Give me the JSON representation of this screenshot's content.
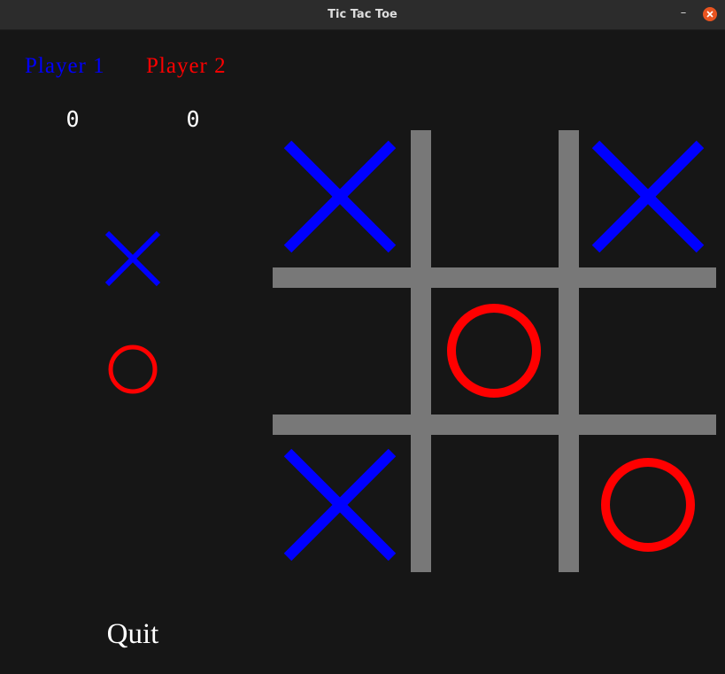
{
  "window": {
    "title": "Tic Tac Toe"
  },
  "players": [
    {
      "label": "Player 1",
      "score": "0",
      "mark": "X",
      "color": "#0000ff"
    },
    {
      "label": "Player 2",
      "score": "0",
      "mark": "O",
      "color": "#ff0000"
    }
  ],
  "quit_label": "Quit",
  "board": [
    "X",
    "",
    "X",
    "",
    "O",
    "",
    "X",
    "",
    "O"
  ],
  "colors": {
    "grid": "#787878",
    "background": "#161616",
    "text": "#ffffff"
  }
}
